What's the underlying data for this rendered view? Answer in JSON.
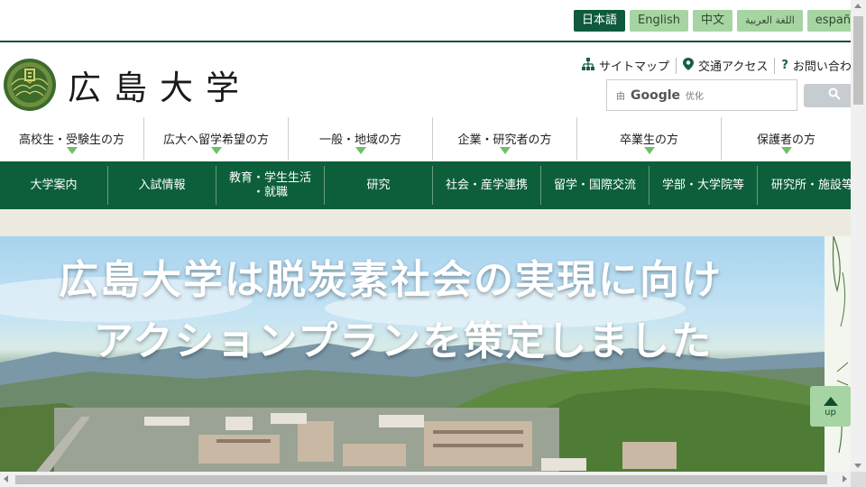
{
  "languages": [
    {
      "label": "日本語",
      "active": true
    },
    {
      "label": "English",
      "active": false
    },
    {
      "label": "中文",
      "active": false
    },
    {
      "label": "اللغة العربية",
      "active": false
    },
    {
      "label": "españo",
      "active": false
    }
  ],
  "header": {
    "logo_text": "広島大学"
  },
  "utility_links": [
    {
      "label": "サイトマップ",
      "icon": "sitemap-icon"
    },
    {
      "label": "交通アクセス",
      "icon": "map-pin-icon"
    },
    {
      "label": "お問い合わ",
      "icon": "question-icon"
    }
  ],
  "search": {
    "prefix": "由",
    "brand": "Google",
    "suffix": "优化",
    "button_icon": "search-icon"
  },
  "audience_nav": [
    {
      "label": "高校生・受験生の方"
    },
    {
      "label": "広大へ留学希望の方"
    },
    {
      "label": "一般・地域の方"
    },
    {
      "label": "企業・研究者の方"
    },
    {
      "label": "卒業生の方"
    },
    {
      "label": "保護者の方"
    }
  ],
  "main_nav": [
    {
      "label": "大学案内"
    },
    {
      "label": "入試情報"
    },
    {
      "label": "教育・学生生活\n・就職"
    },
    {
      "label": "研究"
    },
    {
      "label": "社会・産学連携"
    },
    {
      "label": "留学・国際交流"
    },
    {
      "label": "学部・大学院等"
    },
    {
      "label": "研究所・施設等"
    }
  ],
  "hero": {
    "line1": "広島大学は脱炭素社会の実現に向け",
    "line2": "アクションプランを策定しました"
  },
  "up_button": {
    "label": "up"
  },
  "colors": {
    "brand_green": "#0d5f3b",
    "light_green": "#a7d4a3",
    "band": "#eceadf"
  }
}
